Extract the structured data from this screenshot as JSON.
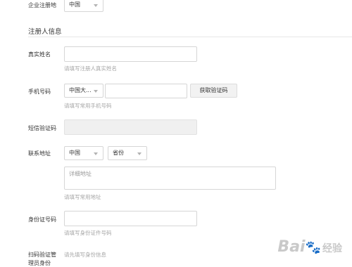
{
  "form": {
    "reg_location": {
      "label": "企业注册地",
      "value": "中国"
    },
    "section_title": "注册人信息",
    "real_name": {
      "label": "真实姓名",
      "value": "",
      "hint": "请填写注册人真实姓名"
    },
    "phone": {
      "label": "手机号码",
      "country_code": "中国大...",
      "value": "",
      "button": "获取验证码",
      "hint": "请填写常用手机号码"
    },
    "sms_code": {
      "label": "短信验证码",
      "value": ""
    },
    "address": {
      "label": "联系地址",
      "country": "中国",
      "province": "省份",
      "detail_placeholder": "详细地址",
      "hint": "请填写常用地址"
    },
    "id_number": {
      "label": "身份证号码",
      "value": "",
      "hint": "请填写身份证件号码"
    },
    "scan_verify": {
      "label_line1": "扫码验证管",
      "label_line2": "理员身份",
      "hint": "请先填写身份信息"
    }
  },
  "watermark": {
    "brand": "Bai",
    "suffix": "经验"
  }
}
